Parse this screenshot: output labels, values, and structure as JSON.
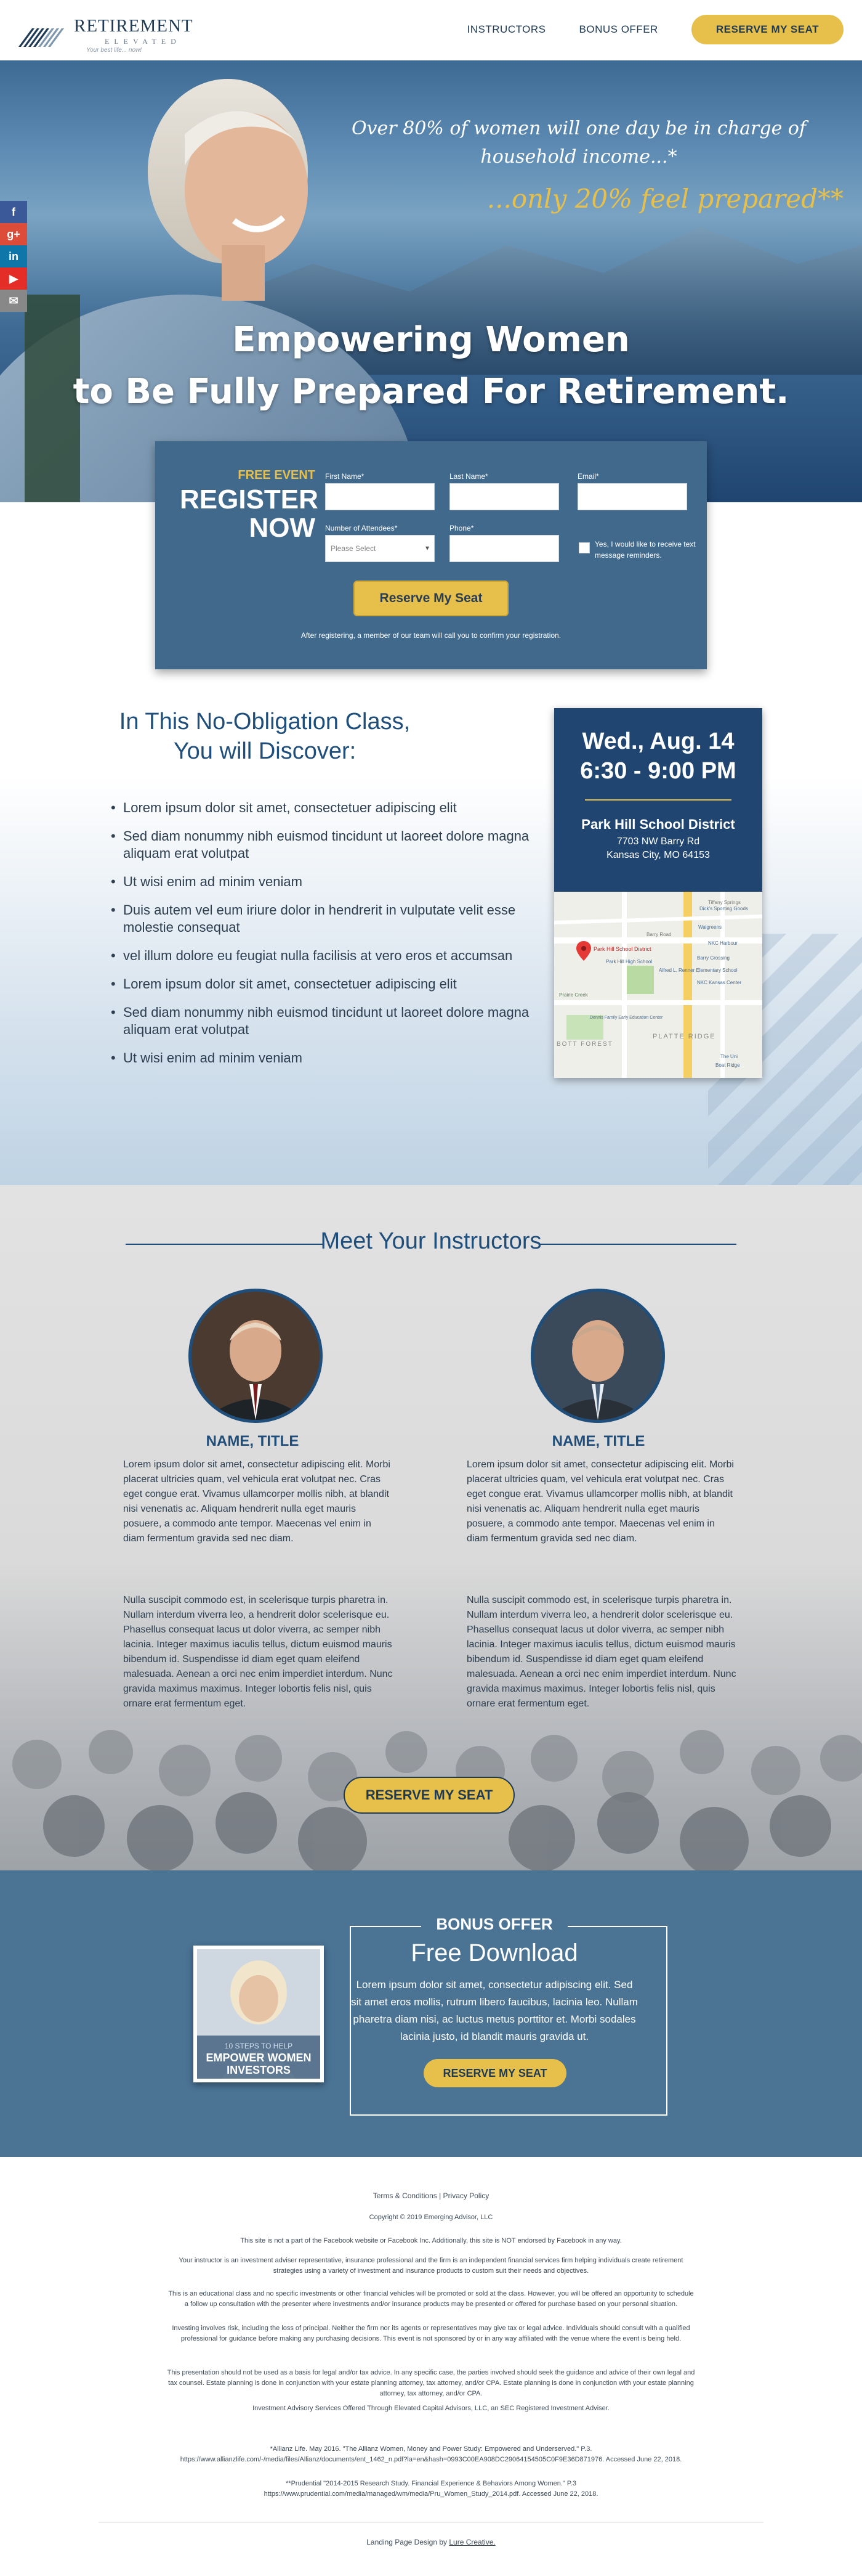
{
  "header": {
    "logo_title": "RETIREMENT",
    "logo_sub": "ELEVATED",
    "logo_tag": "Your best life... now!",
    "nav_instructors": "INSTRUCTORS",
    "nav_bonus": "BONUS OFFER",
    "nav_cta": "RESERVE MY SEAT"
  },
  "hero": {
    "quote1": "Over 80% of women will one day be in charge of household income...*",
    "quote2": "...only 20% feel prepared**",
    "headline_line1": "Empowering Women",
    "headline_line2": "to Be Fully Prepared For Retirement."
  },
  "social": [
    {
      "icon": "facebook-icon",
      "glyph": "f",
      "color": "#3b5998"
    },
    {
      "icon": "google-plus-icon",
      "glyph": "g+",
      "color": "#dd4b39"
    },
    {
      "icon": "linkedin-icon",
      "glyph": "in",
      "color": "#0e76a8"
    },
    {
      "icon": "youtube-icon",
      "glyph": "▶",
      "color": "#e52d27"
    },
    {
      "icon": "email-icon",
      "glyph": "✉",
      "color": "#888888"
    }
  ],
  "form": {
    "free_event": "FREE EVENT",
    "register": "REGISTER",
    "now": "NOW",
    "first_name_label": "First Name*",
    "last_name_label": "Last Name*",
    "email_label": "Email*",
    "attendees_label": "Number of Attendees*",
    "attendees_placeholder": "Please Select",
    "phone_label": "Phone*",
    "checkbox_label": "Yes, I would like to receive text message reminders.",
    "submit": "Reserve My Seat",
    "note": "After registering, a member of our team will call you to confirm your registration."
  },
  "discover": {
    "title_line1": "In This No-Obligation Class,",
    "title_line2": "You will Discover:",
    "items": [
      "Lorem ipsum dolor sit amet, consectetuer adipiscing elit",
      "Sed diam nonummy nibh euismod tincidunt ut laoreet dolore magna aliquam erat volutpat",
      "Ut wisi enim ad minim veniam",
      "Duis autem vel eum iriure dolor in hendrerit in vulputate velit esse molestie consequat",
      "vel illum dolore eu feugiat nulla facilisis at vero eros et accumsan",
      "Lorem ipsum dolor sit amet, consectetuer adipiscing elit",
      "Sed diam nonummy nibh euismod tincidunt ut laoreet dolore magna aliquam erat volutpat",
      "Ut wisi enim ad minim veniam"
    ]
  },
  "event": {
    "date": "Wed., Aug. 14",
    "time": "6:30 - 9:00 PM",
    "venue": "Park Hill School District",
    "address1": "7703 NW Barry Rd",
    "address2": "Kansas City, MO 64153",
    "map": {
      "pin_label": "Park Hill School District",
      "label1": "Park Hill High School",
      "label2": "Alfred L. Renner Elementary School",
      "label3": "Prairie Creek",
      "label4": "Walgreens",
      "label5": "Barry Crossing",
      "label6": "NKC Kansas Center",
      "label7": "Barry Road",
      "label8": "PLATTE RIDGE",
      "label9": "Tiffany Springs",
      "label10": "Dick's Sporting Goods",
      "label11": "NKC Harbour",
      "label12": "Dennis Family Early Education Center",
      "label13": "BOTT FOREST",
      "label14": "The Uni",
      "label15": "Boat Ridge"
    }
  },
  "instructors": {
    "title": "Meet Your Instructors",
    "people": [
      {
        "name": "NAME, TITLE",
        "bio1": "Lorem ipsum dolor sit amet, consectetur adipiscing elit. Morbi placerat ultricies quam, vel vehicula erat volutpat nec. Cras eget congue erat. Vivamus ullamcorper mollis nibh, at blandit nisi venenatis ac. Aliquam hendrerit nulla eget mauris posuere, a commodo ante tempor. Maecenas vel enim in diam fermentum gravida sed nec diam.",
        "bio2": "Nulla suscipit commodo est, in scelerisque turpis pharetra in. Nullam interdum viverra leo, a hendrerit dolor scelerisque eu. Phasellus consequat lacus ut dolor viverra, ac semper nibh lacinia. Integer maximus iaculis tellus, dictum euismod mauris bibendum id. Suspendisse id diam eget quam eleifend malesuada. Aenean a orci nec enim imperdiet interdum. Nunc gravida maximus maximus. Integer lobortis felis nisl, quis ornare erat fermentum eget."
      },
      {
        "name": "NAME, TITLE",
        "bio1": "Lorem ipsum dolor sit amet, consectetur adipiscing elit. Morbi placerat ultricies quam, vel vehicula erat volutpat nec. Cras eget congue erat. Vivamus ullamcorper mollis nibh, at blandit nisi venenatis ac. Aliquam hendrerit nulla eget mauris posuere, a commodo ante tempor. Maecenas vel enim in diam fermentum gravida sed nec diam.",
        "bio2": "Nulla suscipit commodo est, in scelerisque turpis pharetra in. Nullam interdum viverra leo, a hendrerit dolor scelerisque eu. Phasellus consequat lacus ut dolor viverra, ac semper nibh lacinia. Integer maximus iaculis tellus, dictum euismod mauris bibendum id. Suspendisse id diam eget quam eleifend malesuada. Aenean a orci nec enim imperdiet interdum. Nunc gravida maximus maximus. Integer lobortis felis nisl, quis ornare erat fermentum eget."
      }
    ],
    "cta": "RESERVE MY SEAT"
  },
  "bonus": {
    "label": "BONUS OFFER",
    "title": "Free Download",
    "text": "Lorem ipsum dolor sit amet, consectetur adipiscing elit. Sed sit amet eros mollis, rutrum libero faucibus, lacinia leo. Nullam pharetra diam nisi, ac luctus metus porttitor et. Morbi sodales lacinia justo, id blandit mauris gravida ut.",
    "cta": "RESERVE MY SEAT",
    "book_small": "10 STEPS TO HELP",
    "book_title": "EMPOWER WOMEN INVESTORS"
  },
  "footer": {
    "links": "Terms & Conditions | Privacy Policy",
    "copyright": "Copyright © 2019 Emerging Advisor, LLC",
    "p1": "This site is not a part of the Facebook website or Facebook Inc. Additionally, this site is NOT endorsed by Facebook in any way.",
    "p2": "Your instructor is an investment adviser representative, insurance professional and the firm is an independent financial services firm helping individuals create retirement strategies using a variety of investment and insurance products to custom suit their needs and objectives.",
    "p3": "This is an educational class and no specific investments or other financial vehicles will be promoted or sold at the class. However, you will be offered an opportunity to schedule a follow up consultation with the presenter where investments and/or insurance products may be presented or offered for purchase based on your personal situation.",
    "p4": "Investing involves risk, including the loss of principal. Neither the firm nor its agents or representatives may give tax or legal advice. Individuals should consult with a qualified professional for guidance before making any purchasing decisions. This event is not sponsored by or in any way affiliated with the venue where the event is being held.",
    "p5": "This presentation should not be used as a basis for legal and/or tax advice. In any specific case, the parties involved should seek the guidance and advice of their own legal and tax counsel. Estate planning is done in conjunction with your estate planning attorney, tax attorney, and/or CPA. Estate planning is done in conjunction with your estate planning attorney, tax attorney, and/or CPA.",
    "p6": "Investment Advisory Services Offered Through Elevated Capital Advisors, LLC, an SEC Registered Investment Adviser.",
    "p7": "*Allianz Life. May 2016. \"The Allianz Women, Money and Power Study: Empowered and Underserved.\" P.3. https://www.allianzlife.com/-/media/files/Allianz/documents/ent_1462_n.pdf?la=en&hash=0993C00EA908DC29064154505C0F9E36D871976. Accessed June 22, 2018.",
    "p8": "**Prudential \"2014-2015 Research Study. Financial Experience & Behaviors Among Women.\" P.3 https://www.prudential.com/media/managed/wm/media/Pru_Women_Study_2014.pdf. Accessed June 22, 2018.",
    "credit_prefix": "Landing Page Design by ",
    "credit_link": "Lure Creative."
  },
  "colors": {
    "navy": "#1f3a55",
    "accent": "#e6c04b",
    "form_bg": "#41698c",
    "event_bg": "#1f4570",
    "bonus_bg": "#4a7394"
  }
}
